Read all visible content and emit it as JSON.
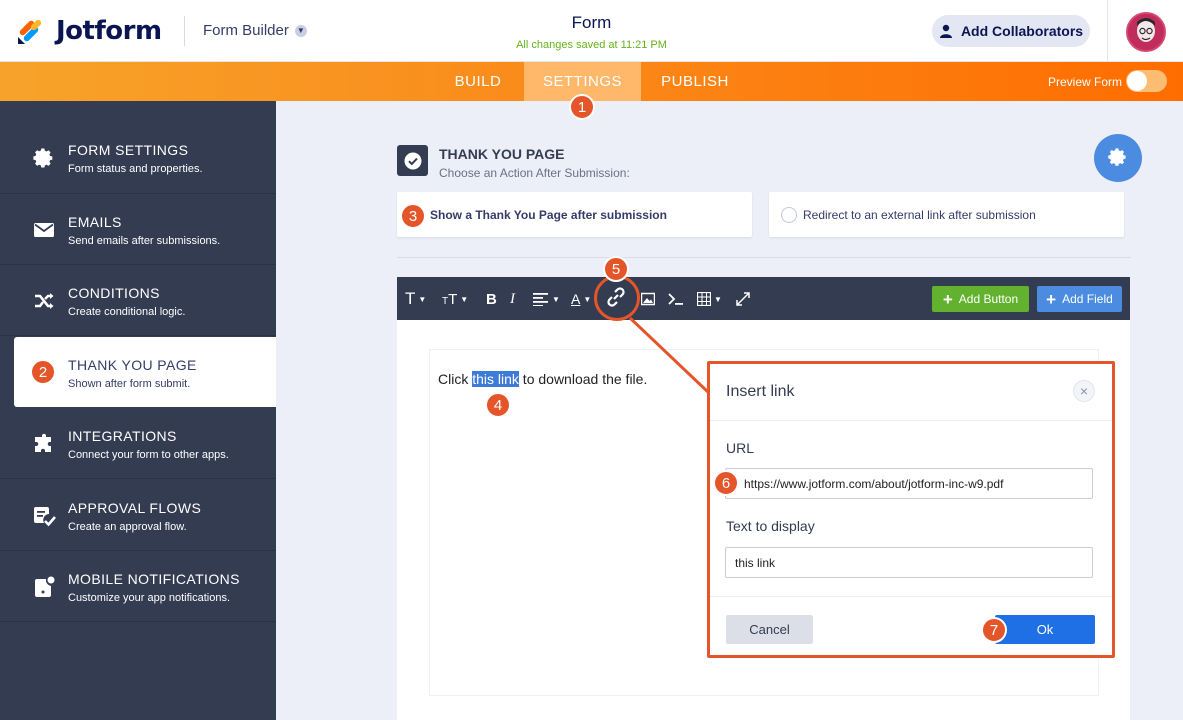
{
  "header": {
    "brand": "Jotform",
    "builder_label": "Form Builder",
    "form_title": "Form",
    "saved_status": "All changes saved at 11:21 PM",
    "collab_label": "Add Collaborators"
  },
  "nav": {
    "tabs": [
      {
        "label": "BUILD"
      },
      {
        "label": "SETTINGS"
      },
      {
        "label": "PUBLISH"
      }
    ],
    "active_tab": "SETTINGS",
    "preview_label": "Preview Form"
  },
  "sidebar": {
    "items": [
      {
        "title": "FORM SETTINGS",
        "subtitle": "Form status and properties."
      },
      {
        "title": "EMAILS",
        "subtitle": "Send emails after submissions."
      },
      {
        "title": "CONDITIONS",
        "subtitle": "Create conditional logic."
      },
      {
        "title": "THANK YOU PAGE",
        "subtitle": "Shown after form submit."
      },
      {
        "title": "INTEGRATIONS",
        "subtitle": "Connect your form to other apps."
      },
      {
        "title": "APPROVAL FLOWS",
        "subtitle": "Create an approval flow."
      },
      {
        "title": "MOBILE NOTIFICATIONS",
        "subtitle": "Customize your app notifications."
      }
    ],
    "active": "THANK YOU PAGE"
  },
  "main": {
    "section_title": "THANK YOU PAGE",
    "section_subtitle": "Choose an Action After Submission:",
    "option_show": "Show a Thank You Page after submission",
    "option_redirect": "Redirect to an external link after submission"
  },
  "editor": {
    "add_button_label": "Add Button",
    "add_field_label": "Add Field",
    "text_before": "Click ",
    "text_selected": "this link",
    "text_after": " to download the file."
  },
  "dialog": {
    "title": "Insert link",
    "url_label": "URL",
    "url_value": "https://www.jotform.com/about/jotform-inc-w9.pdf",
    "display_label": "Text to display",
    "display_value": "this link",
    "cancel_label": "Cancel",
    "ok_label": "Ok"
  },
  "badges": [
    "1",
    "2",
    "3",
    "4",
    "5",
    "6",
    "7"
  ],
  "colors": {
    "accent_orange": "#ff6d00",
    "badge": "#e4552a",
    "sidebar": "#343c52",
    "green": "#64b21b",
    "blue": "#4c8ce0"
  }
}
